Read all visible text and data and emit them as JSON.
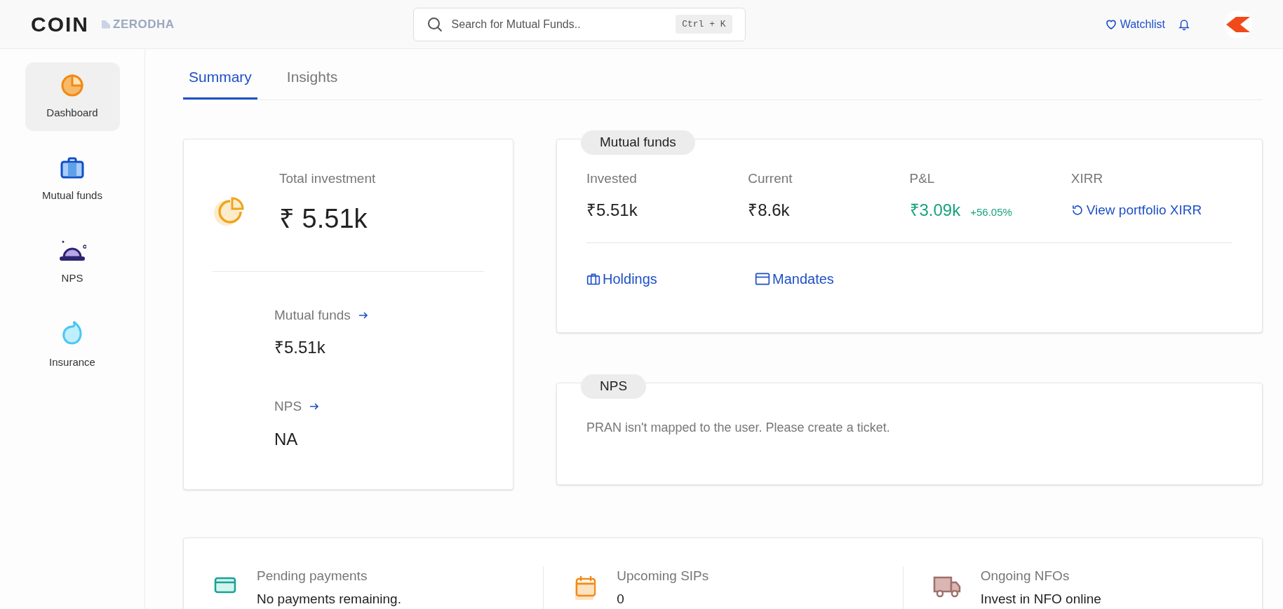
{
  "header": {
    "logo": "COIN",
    "brand": "ZERODHA",
    "search": {
      "placeholder": "Search for Mutual Funds..",
      "shortcut": "Ctrl + K"
    },
    "watchlist": "Watchlist"
  },
  "sidebar": {
    "items": [
      {
        "kind": "dashboard",
        "label": "Dashboard",
        "selected": true
      },
      {
        "kind": "funds",
        "label": "Mutual funds",
        "selected": false
      },
      {
        "kind": "nps",
        "label": "NPS",
        "selected": false
      },
      {
        "kind": "insurance",
        "label": "Insurance",
        "selected": false
      }
    ]
  },
  "tabs": [
    {
      "label": "Summary",
      "selected": true
    },
    {
      "label": "Insights",
      "selected": false
    }
  ],
  "total_card": {
    "label": "Total investment",
    "value": "₹ 5.51k",
    "sections": [
      {
        "label": "Mutual funds",
        "value": "₹5.51k"
      },
      {
        "label": "NPS",
        "value": "NA"
      }
    ]
  },
  "mutual_funds_card": {
    "title": "Mutual funds",
    "stats": [
      {
        "kind": "plain",
        "label": "Invested",
        "value": "₹5.51k"
      },
      {
        "kind": "plain",
        "label": "Current",
        "value": "₹8.6k"
      },
      {
        "kind": "gain",
        "label": "P&L",
        "value": "₹3.09k",
        "change": "+56.05%"
      },
      {
        "kind": "link",
        "label": "XIRR",
        "value": "View portfolio XIRR"
      }
    ],
    "links": [
      {
        "kind": "holdings",
        "label": "Holdings"
      },
      {
        "kind": "mandates",
        "label": "Mandates"
      }
    ]
  },
  "nps_card": {
    "title": "NPS",
    "message": "PRAN isn't mapped to the user. Please create a ticket."
  },
  "bottom_card": {
    "items": [
      {
        "kind": "payments",
        "label": "Pending payments",
        "value": "No payments remaining."
      },
      {
        "kind": "sips",
        "label": "Upcoming SIPs",
        "value": "0"
      },
      {
        "kind": "nfos",
        "label": "Ongoing NFOs",
        "value": "Invest in NFO online"
      }
    ]
  }
}
